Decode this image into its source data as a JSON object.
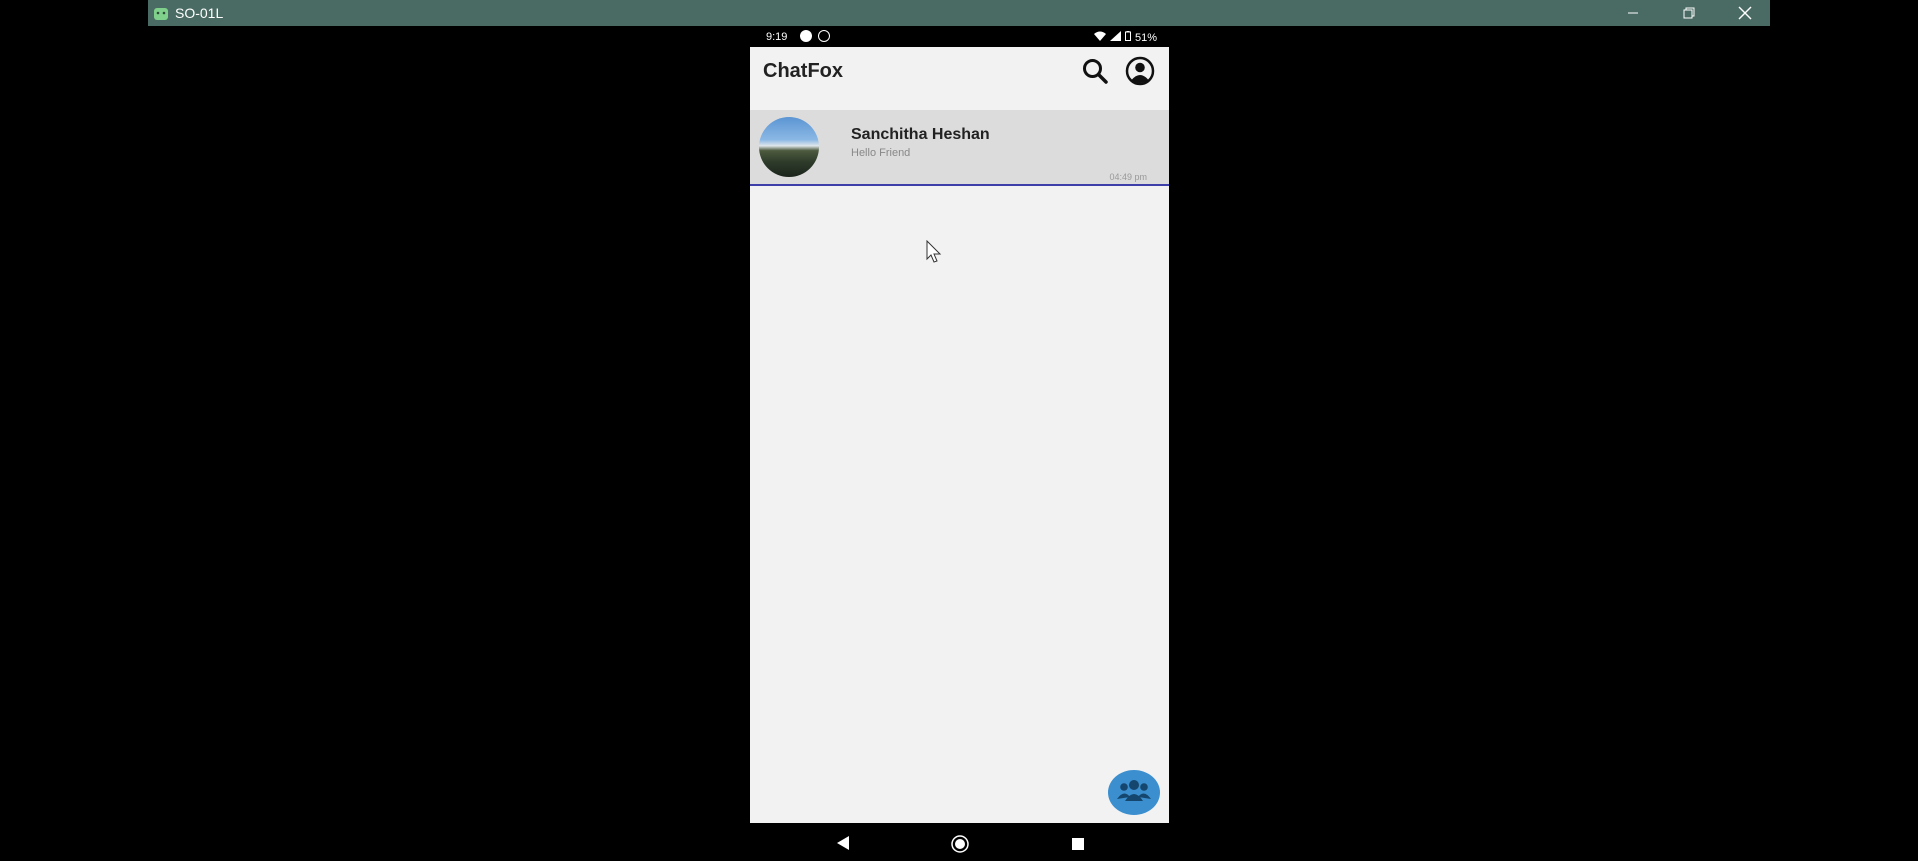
{
  "window": {
    "title": "SO-01L"
  },
  "status_bar": {
    "time": "9:19",
    "battery": "51%"
  },
  "app": {
    "title": "ChatFox"
  },
  "chats": [
    {
      "name": "Sanchitha Heshan",
      "last_message": "Hello Friend",
      "time": "04:49 pm"
    }
  ],
  "icons": {
    "search": "search-icon",
    "account": "account-circle-icon",
    "fab": "group-icon"
  },
  "colors": {
    "titlebar": "#4a6b63",
    "selection_underline": "#3e3fa8",
    "fab": "#3b8fcf"
  }
}
